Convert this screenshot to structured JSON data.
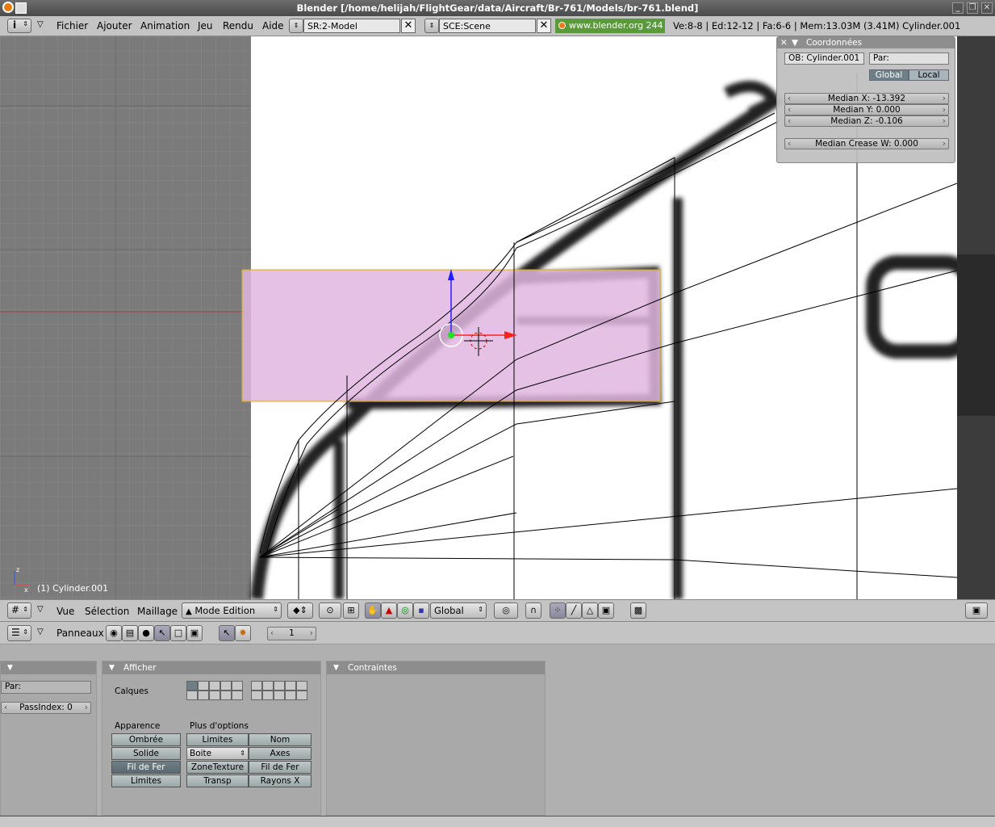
{
  "window": {
    "title": "Blender [/home/helijah/FlightGear/data/Aircraft/Br-761/Models/br-761.blend]"
  },
  "topbar": {
    "menus": [
      "Fichier",
      "Ajouter",
      "Animation",
      "Jeu",
      "Rendu",
      "Aide"
    ],
    "screen": "SR:2-Model",
    "scene": "SCE:Scene",
    "link": "www.blender.org 244",
    "stats": "Ve:8-8 | Ed:12-12 | Fa:6-6 | Mem:13.03M (3.41M) Cylinder.001"
  },
  "viewport": {
    "object_label": "(1) Cylinder.001",
    "axis_z": "z",
    "axis_x": "x"
  },
  "coords_panel": {
    "title": "Coordonnées",
    "ob_field": "OB: Cylinder.001",
    "par_field": "Par:",
    "global_label": "Global",
    "local_label": "Local",
    "median_x": "Median X: -13.392",
    "median_y": "Median Y: 0.000",
    "median_z": "Median Z: -0.106",
    "median_crease": "Median Crease W: 0.000"
  },
  "view_header": {
    "menus": [
      "Vue",
      "Sélection",
      "Maillage"
    ],
    "mode": "Mode Edition",
    "orientation": "Global"
  },
  "buttons_header": {
    "panels_label": "Panneaux",
    "frame": "1"
  },
  "panels": {
    "left": {
      "par": "Par:",
      "pass_index": "PassIndex: 0"
    },
    "afficher": {
      "title": "Afficher",
      "calques": "Calques",
      "apparence": "Apparence",
      "plus_options": "Plus d'options",
      "btn_ombree": "Ombrée",
      "btn_solide": "Solide",
      "btn_fil": "Fil de Fer",
      "btn_limites": "Limites",
      "btn_limites2": "Limites",
      "btn_nom": "Nom",
      "boite": "Boite",
      "btn_axes": "Axes",
      "btn_zone": "ZoneTexture",
      "btn_fil2": "Fil de Fer",
      "btn_transp": "Transp",
      "btn_rayons": "Rayons X"
    },
    "contraintes": {
      "title": "Contraintes"
    }
  },
  "colors": {
    "selection": "#e8bfe8",
    "grid_bg": "#7b7b7b",
    "accent_link": "#5a9a3a"
  }
}
